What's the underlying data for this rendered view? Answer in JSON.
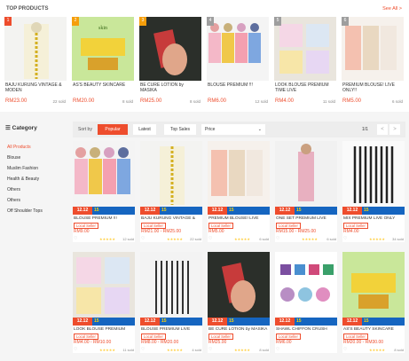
{
  "header": {
    "title": "TOP PRODUCTS",
    "see_all": "See All >"
  },
  "top_products": [
    {
      "rank": "1",
      "name": "BAJU KURUNG VINTAGE & MODEN",
      "price": "RM23.00",
      "sold": "22 sold",
      "badge_color": "#ee4d2d"
    },
    {
      "rank": "2",
      "name": "AS'S BEAUTY SKINCARE",
      "price": "RM20.00",
      "sold": "8 sold",
      "badge_color": "#f59e0b"
    },
    {
      "rank": "3",
      "name": "BE CURE LOTION by MASIKA",
      "price": "RM25.00",
      "sold": "8 sold",
      "badge_color": "#f59e0b"
    },
    {
      "rank": "4",
      "name": "BLOUSE PREMIUM !!!",
      "price": "RM6.00",
      "sold": "12 sold",
      "badge_color": "#9e9e9e"
    },
    {
      "rank": "5",
      "name": "LOOK BLOUSE PREMIUM TIME LIVE",
      "price": "RM4.00",
      "sold": "11 sold",
      "badge_color": "#9e9e9e"
    },
    {
      "rank": "6",
      "name": "PREMIUM BLOUSE! LIVE ONLY!!",
      "price": "RM5.00",
      "sold": "6 sold",
      "badge_color": "#9e9e9e"
    }
  ],
  "sidebar": {
    "heading": "Category",
    "items": [
      "All Products",
      "Blouse",
      "Muslim Fashion",
      "Health & Beauty",
      "Others",
      "Others",
      "Off Shoulder Tops"
    ]
  },
  "sortbar": {
    "label": "Sort by",
    "buttons": [
      "Popular",
      "Latest",
      "Top Sales"
    ],
    "price_select": "Price",
    "page": "1/1",
    "prev": "<",
    "next": ">"
  },
  "products": [
    {
      "name": "BLOUSE PREMIUM !!!",
      "tag": "Local Seller",
      "price": "RM9.00",
      "rating": "★★★★★",
      "sold": "12 sold",
      "loc": "Kelantan",
      "strip": "12.12",
      "num": "15"
    },
    {
      "name": "BAJU KURUNG VINTAGE &",
      "tag": "Local Seller",
      "price": "RM21.00 - RM25.00",
      "rating": "★★★★★",
      "sold": "22 sold",
      "loc": "Kelantan",
      "strip": "12.12",
      "num": "15"
    },
    {
      "name": "PREMIUM BLOUSE! LIVE",
      "tag": "Local Seller",
      "price": "RM5.00",
      "rating": "★★★★★",
      "sold": "6 sold",
      "loc": "Kelantan",
      "strip": "12.12",
      "num": "15"
    },
    {
      "name": "ONE SET PREMIUM LIVE",
      "tag": "Local Seller",
      "price": "RM15.00 - RM25.00",
      "rating": "★★★★★",
      "sold": "6 sold",
      "loc": "Kelantan",
      "strip": "12.12",
      "num": "15"
    },
    {
      "name": "MIX PREMIUM LIVE ONLY",
      "tag": "Local Seller",
      "price": "RM4.00",
      "rating": "★★★★★",
      "sold": "34 sold",
      "loc": "Kelantan",
      "strip": "12.12",
      "num": "15"
    },
    {
      "name": "LOOK BLOUSE PREMIUM",
      "tag": "Local Seller",
      "price": "RM4.00 - RM10.00",
      "rating": "★★★★★",
      "sold": "11 sold",
      "loc": "Kelantan",
      "strip": "12.12",
      "num": "15"
    },
    {
      "name": "BLOUSE PREMIUM LIVE",
      "tag": "Local Seller",
      "price": "RM8.00 - RM20.00",
      "rating": "★★★★★",
      "sold": "4 sold",
      "loc": "Kelantan",
      "strip": "12.12",
      "num": "15"
    },
    {
      "name": "BE CURE LOTION by MASIKA",
      "tag": "Local Seller",
      "price": "RM25.00",
      "rating": "★★★★★",
      "sold": "8 sold",
      "loc": "Kelantan",
      "strip": "12.12",
      "num": "15"
    },
    {
      "name": "SHAWL CHIFFON CRUSH",
      "tag": "Local Seller",
      "price": "RM6.00",
      "rating": "",
      "sold": "",
      "loc": "Kelantan",
      "strip": "12.12",
      "num": "15"
    },
    {
      "name": "AS'S BEAUTY SKINCARE",
      "tag": "Local Seller",
      "price": "RM20.00 - RM30.00",
      "rating": "★★★★★",
      "sold": "8 sold",
      "loc": "Kelantan",
      "strip": "12.12",
      "num": "15"
    }
  ]
}
